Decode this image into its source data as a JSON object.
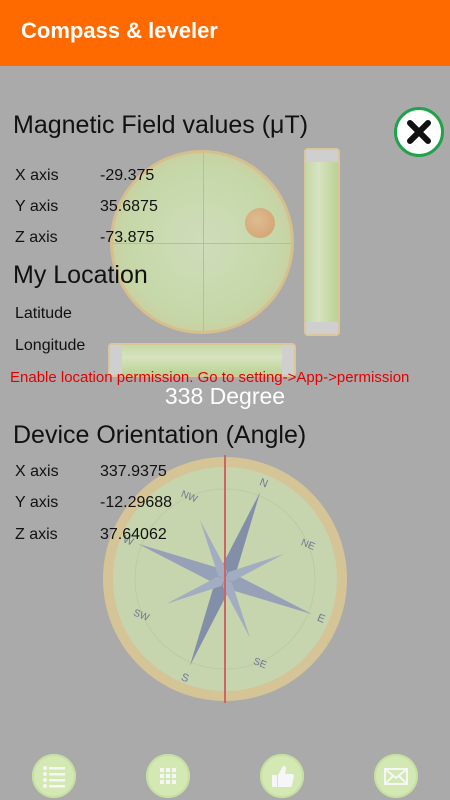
{
  "app": {
    "title": "Compass & leveler"
  },
  "magnetic": {
    "heading": "Magnetic Field values (μT)",
    "rows": [
      {
        "label": "X axis",
        "value": "-29.375"
      },
      {
        "label": "Y axis",
        "value": "35.6875"
      },
      {
        "label": "Z axis",
        "value": "-73.875"
      }
    ]
  },
  "location": {
    "heading": "My Location",
    "latitude_label": "Latitude",
    "longitude_label": "Longitude",
    "permission_message": "Enable location permission. Go to setting->App->permission"
  },
  "compass": {
    "degree_text": "338 Degree",
    "cardinals": [
      "N",
      "NE",
      "E",
      "SE",
      "S",
      "SW",
      "W",
      "NW"
    ]
  },
  "orientation": {
    "heading": "Device Orientation (Angle)",
    "rows": [
      {
        "label": "X axis",
        "value": "337.9375"
      },
      {
        "label": "Y axis",
        "value": "-12.29688"
      },
      {
        "label": "Z axis",
        "value": "37.64062"
      }
    ]
  },
  "bottom_nav": [
    "list-icon",
    "grid-icon",
    "thumbs-up-icon",
    "mail-icon"
  ],
  "colors": {
    "appbar": "#ff6a00",
    "background": "#aaaaaa",
    "error": "#e60000",
    "close_border": "#1fa24a"
  }
}
